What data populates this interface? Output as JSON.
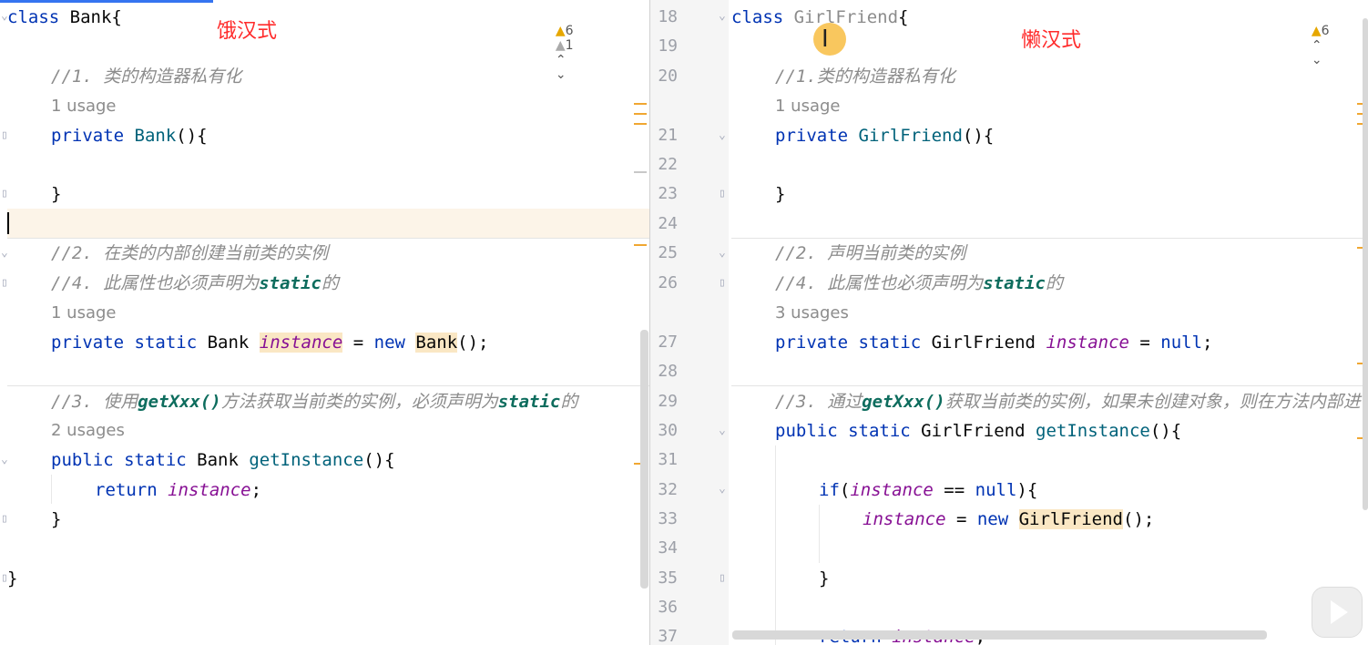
{
  "annotations": {
    "left": "饿汉式",
    "right": "懒汉式"
  },
  "left": {
    "inspections": {
      "warnings": "6",
      "weak_warnings": "1"
    },
    "code": {
      "class_kw": "class",
      "class_name": " Bank{",
      "c1": "//1. 类的构造器私有化",
      "u1": "1 usage",
      "ctor_kw": "private ",
      "ctor_name": "Bank",
      "ctor_rest": "(){",
      "close1": "}",
      "c2": "//2. 在类的内部创建当前类的实例",
      "c4a": "//4. 此属性也必须声明为",
      "c4b": "static",
      "c4c": "的",
      "u2": "1 usage",
      "f_kw": "private static ",
      "f_type": "Bank ",
      "f_name": "instance",
      "f_eq": " = ",
      "f_new": "new ",
      "f_cls": "Bank",
      "f_end": "();",
      "c3a": "//3. 使用",
      "c3b": "getXxx()",
      "c3c": "方法获取当前类的实例，必须声明为",
      "c3d": "static",
      "c3e": "的",
      "u3": "2 usages",
      "m_kw": "public static ",
      "m_type": "Bank ",
      "m_name": "getInstance",
      "m_rest": "(){",
      "r_kw": "return ",
      "r_name": "instance",
      "r_end": ";",
      "close2": "}",
      "close3": "}"
    }
  },
  "right": {
    "inspections": {
      "warnings": "6"
    },
    "line_numbers": [
      "18",
      "19",
      "20",
      "21",
      "22",
      "23",
      "24",
      "25",
      "26",
      "27",
      "28",
      "29",
      "30",
      "31",
      "32",
      "33",
      "34",
      "35",
      "36",
      "37"
    ],
    "code": {
      "class_kw": "class ",
      "class_name": "GirlFriend",
      "class_end": "{",
      "c1": "//1.类的构造器私有化",
      "u1": "1 usage",
      "ctor_kw": "private ",
      "ctor_name": "GirlFriend",
      "ctor_rest": "(){",
      "close1": "}",
      "c2": "//2. 声明当前类的实例",
      "c4a": "//4. 此属性也必须声明为",
      "c4b": "static",
      "c4c": "的",
      "u2": "3 usages",
      "f_kw": "private static ",
      "f_type": "GirlFriend ",
      "f_name": "instance",
      "f_eq": " = ",
      "f_null": "null",
      "f_end": ";",
      "c3a": "//3. 通过",
      "c3b": "getXxx()",
      "c3c": "获取当前类的实例，如果未创建对象，则在方法内部进",
      "m_kw": "public static ",
      "m_type": "GirlFriend ",
      "m_name": "getInstance",
      "m_rest": "(){",
      "if_kw": "if",
      "if_p": "(",
      "if_name": "instance",
      "if_eq": " == ",
      "if_null": "null",
      "if_end": "){",
      "a_name": "instance",
      "a_eq": " = ",
      "a_new": "new ",
      "a_cls": "GirlFriend",
      "a_end": "();",
      "close_if": "}",
      "r_kw": "return ",
      "r_name": "instance",
      "r_end": ";"
    }
  }
}
